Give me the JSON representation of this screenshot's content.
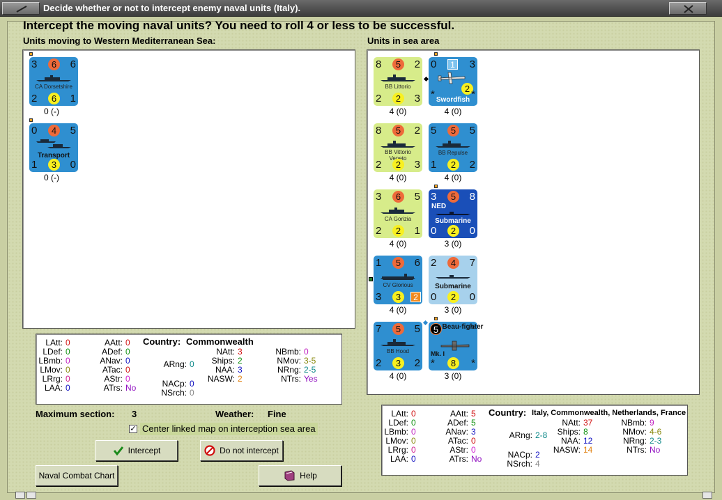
{
  "window": {
    "title": "Decide whether or not to intercept enemy naval units (Italy)."
  },
  "heading": "Intercept the moving naval units?  You need to roll 4 or less to be successful.",
  "left_panel": {
    "label": "Units moving to Western Mediterranean Sea:",
    "units": [
      {
        "name": "CA Dorsetshire",
        "tl": "3",
        "top": "6",
        "tr": "6",
        "bl": "2",
        "bot": "6",
        "br": "1",
        "caption": "0 (-)"
      },
      {
        "name": "Transport",
        "tl": "0",
        "top": "4",
        "tr": "5",
        "bl": "1",
        "bot": "3",
        "br": "0",
        "caption": "0 (-)"
      }
    ]
  },
  "right_panel": {
    "label": "Units in sea area",
    "units": [
      {
        "name": "BB Littorio",
        "tl": "8",
        "top": "5",
        "tr": "2",
        "bl": "2",
        "bot": "2",
        "br": "3",
        "caption": "4 (0)"
      },
      {
        "name": "Swordfish",
        "tl": "0",
        "top": "1",
        "tr": "3",
        "bl": "*",
        "bot": "2",
        "br": "*",
        "caption": "4 (0)"
      },
      {
        "name": "BB Vittorio Veneto",
        "tl": "8",
        "top": "5",
        "tr": "2",
        "bl": "2",
        "bot": "2",
        "br": "3",
        "caption": "4 (0)"
      },
      {
        "name": "BB Repulse",
        "tl": "5",
        "top": "5",
        "tr": "5",
        "bl": "1",
        "bot": "2",
        "br": "2",
        "caption": "4 (0)"
      },
      {
        "name": "CA Gorizia",
        "tl": "3",
        "top": "6",
        "tr": "5",
        "bl": "2",
        "bot": "2",
        "br": "1",
        "caption": "4 (0)"
      },
      {
        "name": "Submarine",
        "tag": "NED",
        "tl": "3",
        "top": "5",
        "tr": "8",
        "bl": "0",
        "bot": "2",
        "br": "0",
        "caption": "3 (0)"
      },
      {
        "name": "CV Glorious",
        "tl": "1",
        "top": "5",
        "tr": "6",
        "bl": "3",
        "bot": "3",
        "br": "2",
        "caption": "4 (0)"
      },
      {
        "name": "Submarine",
        "tl": "2",
        "top": "4",
        "tr": "7",
        "bl": "0",
        "bot": "2",
        "br": "0",
        "caption": "3 (0)"
      },
      {
        "name": "BB Hood",
        "tl": "7",
        "top": "5",
        "tr": "5",
        "bl": "2",
        "bot": "3",
        "br": "2",
        "caption": "4 (0)"
      },
      {
        "name": "Beau-fighter",
        "sub": "Mk. I",
        "tl": "5",
        "top": "",
        "tr": "*",
        "bl": "*",
        "bot": "8",
        "br": "*",
        "caption": "3 (0)"
      }
    ]
  },
  "left_stats": {
    "country_label": "Country:",
    "country": "Commonwealth",
    "rows": [
      {
        "k": "LAtt:",
        "v": "0",
        "c": "#d01010"
      },
      {
        "k": "LDef:",
        "v": "0",
        "c": "#109010"
      },
      {
        "k": "LBmb:",
        "v": "0",
        "c": "#c020c0"
      },
      {
        "k": "LMov:",
        "v": "0",
        "c": "#8a8a10"
      },
      {
        "k": "LRrg:",
        "v": "0",
        "c": "#d02090"
      },
      {
        "k": "LAA:",
        "v": "0",
        "c": "#1010c0"
      },
      {
        "k": "AAtt:",
        "v": "0",
        "c": "#d01010"
      },
      {
        "k": "ADef:",
        "v": "0",
        "c": "#109010"
      },
      {
        "k": "ANav:",
        "v": "0",
        "c": "#1010c0"
      },
      {
        "k": "ATac:",
        "v": "0",
        "c": "#d01010"
      },
      {
        "k": "AStr:",
        "v": "0",
        "c": "#d020d0"
      },
      {
        "k": "ATrs:",
        "v": "No",
        "c": "#9010c0"
      },
      {
        "k": "ARng:",
        "v": "0",
        "c": "#108a8a"
      },
      {
        "k": "NACp:",
        "v": "0",
        "c": "#1010c0"
      },
      {
        "k": "NSrch:",
        "v": "0",
        "c": "#888888"
      },
      {
        "k": "NAtt:",
        "v": "3",
        "c": "#d01010"
      },
      {
        "k": "Ships:",
        "v": "2",
        "c": "#109010"
      },
      {
        "k": "NAA:",
        "v": "3",
        "c": "#1010c0"
      },
      {
        "k": "NASW:",
        "v": "2",
        "c": "#e08010"
      },
      {
        "k": "NBmb:",
        "v": "0",
        "c": "#c020c0"
      },
      {
        "k": "NMov:",
        "v": "3-5",
        "c": "#8a8a10"
      },
      {
        "k": "NRng:",
        "v": "2-5",
        "c": "#108a8a"
      },
      {
        "k": "NTrs:",
        "v": "Yes",
        "c": "#9010c0"
      }
    ]
  },
  "right_stats": {
    "country_label": "Country:",
    "country": "Italy, Commonwealth, Netherlands, France",
    "rows": [
      {
        "k": "LAtt:",
        "v": "0",
        "c": "#d01010"
      },
      {
        "k": "LDef:",
        "v": "0",
        "c": "#109010"
      },
      {
        "k": "LBmb:",
        "v": "0",
        "c": "#c020c0"
      },
      {
        "k": "LMov:",
        "v": "0",
        "c": "#8a8a10"
      },
      {
        "k": "LRrg:",
        "v": "0",
        "c": "#d02090"
      },
      {
        "k": "LAA:",
        "v": "0",
        "c": "#1010c0"
      },
      {
        "k": "AAtt:",
        "v": "5",
        "c": "#d01010"
      },
      {
        "k": "ADef:",
        "v": "5",
        "c": "#109010"
      },
      {
        "k": "ANav:",
        "v": "3",
        "c": "#1010c0"
      },
      {
        "k": "ATac:",
        "v": "0",
        "c": "#d01010"
      },
      {
        "k": "AStr:",
        "v": "0",
        "c": "#d020d0"
      },
      {
        "k": "ATrs:",
        "v": "No",
        "c": "#9010c0"
      },
      {
        "k": "ARng:",
        "v": "2-8",
        "c": "#108a8a"
      },
      {
        "k": "NACp:",
        "v": "2",
        "c": "#1010c0"
      },
      {
        "k": "NSrch:",
        "v": "4",
        "c": "#888888"
      },
      {
        "k": "NAtt:",
        "v": "37",
        "c": "#d01010"
      },
      {
        "k": "Ships:",
        "v": "8",
        "c": "#109010"
      },
      {
        "k": "NAA:",
        "v": "12",
        "c": "#1010c0"
      },
      {
        "k": "NASW:",
        "v": "14",
        "c": "#e08010"
      },
      {
        "k": "NBmb:",
        "v": "9",
        "c": "#c020c0"
      },
      {
        "k": "NMov:",
        "v": "4-6",
        "c": "#8a8a10"
      },
      {
        "k": "NRng:",
        "v": "2-3",
        "c": "#108a8a"
      },
      {
        "k": "NTrs:",
        "v": "No",
        "c": "#9010c0"
      }
    ]
  },
  "info": {
    "max_section_label": "Maximum section:",
    "max_section_value": "3",
    "weather_label": "Weather:",
    "weather_value": "Fine",
    "center_map_label": "Center linked map on interception sea area",
    "center_map_checked": true
  },
  "buttons": {
    "intercept": "Intercept",
    "do_not_intercept": "Do not intercept",
    "naval_combat_chart": "Naval Combat Chart",
    "help": "Help"
  }
}
